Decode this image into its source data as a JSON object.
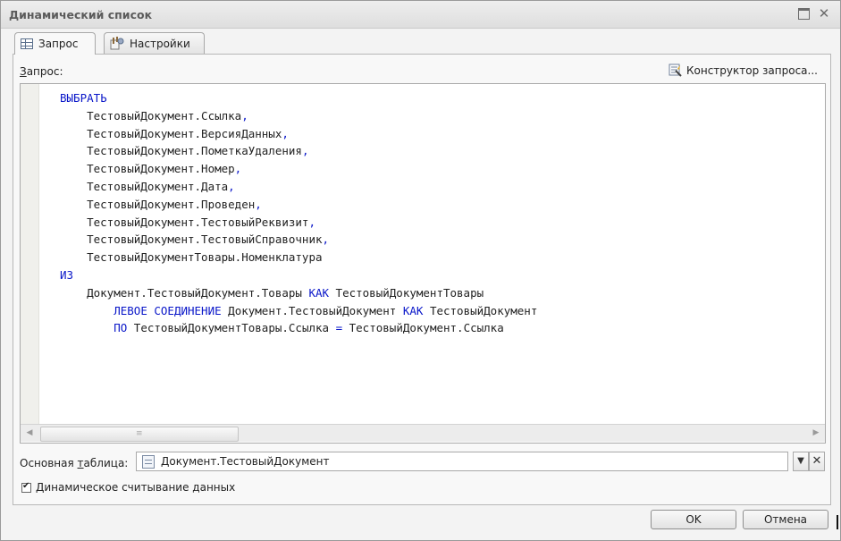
{
  "window": {
    "title": "Динамический список"
  },
  "tabs": [
    {
      "label": "Запрос",
      "icon": "table-icon",
      "active": true
    },
    {
      "label": "Настройки",
      "icon": "settings-icon",
      "active": false
    }
  ],
  "query": {
    "label_accel": "З",
    "label_rest": "апрос:",
    "constructor_label": "Конструктор запроса..."
  },
  "code_lines": [
    [
      {
        "t": "ВЫБРАТЬ",
        "c": "kw"
      }
    ],
    [
      {
        "t": "    ТестовыйДокумент.Ссылка"
      },
      {
        "t": ",",
        "c": "op"
      }
    ],
    [
      {
        "t": "    ТестовыйДокумент.ВерсияДанных"
      },
      {
        "t": ",",
        "c": "op"
      }
    ],
    [
      {
        "t": "    ТестовыйДокумент.ПометкаУдаления"
      },
      {
        "t": ",",
        "c": "op"
      }
    ],
    [
      {
        "t": "    ТестовыйДокумент.Номер"
      },
      {
        "t": ",",
        "c": "op"
      }
    ],
    [
      {
        "t": "    ТестовыйДокумент.Дата"
      },
      {
        "t": ",",
        "c": "op"
      }
    ],
    [
      {
        "t": "    ТестовыйДокумент.Проведен"
      },
      {
        "t": ",",
        "c": "op"
      }
    ],
    [
      {
        "t": "    ТестовыйДокумент.ТестовыйРеквизит"
      },
      {
        "t": ",",
        "c": "op"
      }
    ],
    [
      {
        "t": "    ТестовыйДокумент.ТестовыйСправочник"
      },
      {
        "t": ",",
        "c": "op"
      }
    ],
    [
      {
        "t": "    ТестовыйДокументТовары.Номенклатура"
      }
    ],
    [
      {
        "t": "ИЗ",
        "c": "kw"
      }
    ],
    [
      {
        "t": "    Документ.ТестовыйДокумент.Товары "
      },
      {
        "t": "КАК",
        "c": "kw"
      },
      {
        "t": " ТестовыйДокументТовары"
      }
    ],
    [
      {
        "t": "        "
      },
      {
        "t": "ЛЕВОЕ СОЕДИНЕНИЕ",
        "c": "kw"
      },
      {
        "t": " Документ.ТестовыйДокумент "
      },
      {
        "t": "КАК",
        "c": "kw"
      },
      {
        "t": " ТестовыйДокумент"
      }
    ],
    [
      {
        "t": "        "
      },
      {
        "t": "ПО",
        "c": "kw"
      },
      {
        "t": " ТестовыйДокументТовары.Ссылка "
      },
      {
        "t": "=",
        "c": "op"
      },
      {
        "t": " ТестовыйДокумент.Ссылка"
      }
    ]
  ],
  "main_table": {
    "label_before": "Основная ",
    "label_accel": "т",
    "label_after": "аблица:",
    "value": "Документ.ТестовыйДокумент"
  },
  "dynamic_read": {
    "label": "Динамическое считывание данных",
    "checked": true
  },
  "buttons": {
    "ok": "OK",
    "cancel": "Отмена"
  },
  "colors": {
    "keyword": "#0a17c9",
    "text": "#222222"
  }
}
